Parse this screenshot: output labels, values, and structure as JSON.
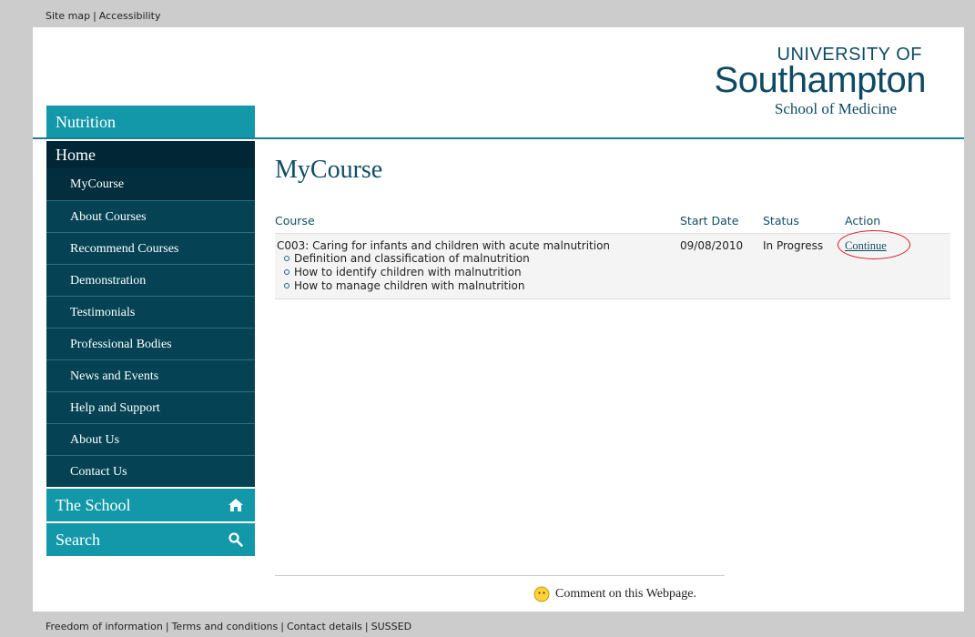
{
  "top_links": [
    "Site map",
    "Accessibility"
  ],
  "logo": {
    "university_of": "UNIVERSITY OF",
    "name": "Southampton",
    "school": "School of Medicine"
  },
  "site_section": "Nutrition",
  "sidebar": {
    "home": "Home",
    "items": [
      {
        "label": "MyCourse",
        "active": true
      },
      {
        "label": "About Courses"
      },
      {
        "label": "Recommend Courses"
      },
      {
        "label": "Demonstration"
      },
      {
        "label": "Testimonials"
      },
      {
        "label": "Professional Bodies"
      },
      {
        "label": "News and Events"
      },
      {
        "label": "Help and Support"
      },
      {
        "label": "About Us"
      },
      {
        "label": "Contact Us"
      }
    ],
    "school": {
      "label": "The School",
      "icon": "home-icon"
    },
    "search": {
      "label": "Search",
      "icon": "magnifier-icon"
    }
  },
  "main": {
    "title": "MyCourse",
    "table": {
      "headers": [
        "Course",
        "Start Date",
        "Status",
        "Action"
      ],
      "rows": [
        {
          "course": "C003: Caring for infants and children with acute malnutrition",
          "topics": [
            "Definition and classification of malnutrition",
            "How to identify children with malnutrition",
            "How to manage children with malnutrition"
          ],
          "start_date": "09/08/2010",
          "status": "In Progress",
          "action": "Continue"
        }
      ]
    }
  },
  "comment": "Comment on this Webpage.",
  "footer_links": [
    "Freedom of information",
    "Terms and conditions",
    "Contact details",
    "SUSSED"
  ],
  "colors": {
    "teal": "#1298a9",
    "navy": "#054354",
    "dark_navy": "#012636",
    "accent_text": "#0f4e66",
    "highlight_circle": "#d81c1c"
  }
}
